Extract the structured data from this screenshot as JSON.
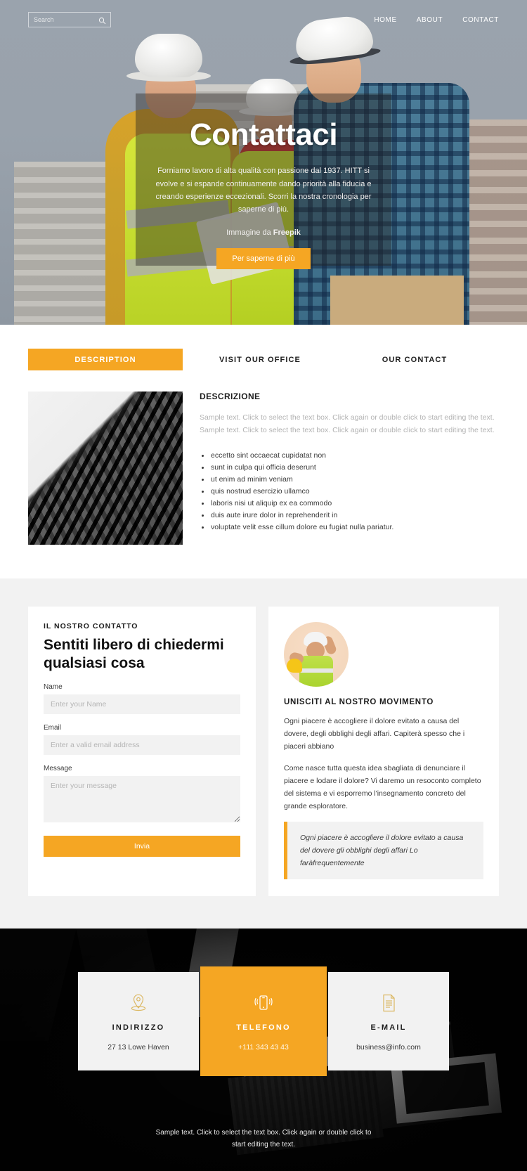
{
  "topbar": {
    "search": {
      "placeholder": "Search",
      "value": "",
      "icon": "search-icon"
    },
    "nav": [
      {
        "label": "HOME"
      },
      {
        "label": "ABOUT"
      },
      {
        "label": "CONTACT"
      }
    ]
  },
  "hero": {
    "title": "Contattaci",
    "description": "Forniamo lavoro di alta qualità con passione dal 1937. HITT si evolve e si espande continuamente dando priorità alla fiducia e creando esperienze eccezionali. Scorri la nostra cronologia per saperne di più.",
    "credit_prefix": "Immagine da ",
    "credit_source": "Freepik",
    "button_label": "Per saperne di più"
  },
  "tabs_section": {
    "tabs": [
      {
        "label": "DESCRIPTION",
        "active": true
      },
      {
        "label": "VISIT OUR OFFICE",
        "active": false
      },
      {
        "label": "OUR CONTACT",
        "active": false
      }
    ],
    "panel": {
      "title": "DESCRIZIONE",
      "paragraph": "Sample text. Click to select the text box. Click again or double click to start editing the text. Sample text. Click to select the text box. Click again or double click to start editing the text.",
      "list": [
        "eccetto sint occaecat cupidatat non",
        "sunt in culpa qui officia deserunt",
        "ut enim ad minim veniam",
        "quis nostrud esercizio ullamco",
        "laboris nisi ut aliquip ex ea commodo",
        "duis aute irure dolor in reprehenderit in",
        "voluptate velit esse cillum dolore eu fugiat nulla pariatur."
      ]
    }
  },
  "contact_section": {
    "form_card": {
      "eyebrow": "IL NOSTRO CONTATTO",
      "heading": "Sentiti libero di chiedermi qualsiasi cosa",
      "fields": [
        {
          "label": "Name",
          "placeholder": "Enter your Name",
          "value": ""
        },
        {
          "label": "Email",
          "placeholder": "Enter a valid email address",
          "value": ""
        },
        {
          "label": "Message",
          "placeholder": "Enter your message",
          "value": ""
        }
      ],
      "submit_label": "Invia"
    },
    "movement_card": {
      "avatar": "worker-avatar",
      "heading": "UNISCITI AL NOSTRO MOVIMENTO",
      "paragraph1": "Ogni piacere è accogliere il dolore evitato a causa del dovere, degli obblighi degli affari. Capiterà spesso che i piaceri abbiano",
      "paragraph2": "Come nasce tutta questa idea sbagliata di denunciare il piacere e lodare il dolore? Vi daremo un resoconto completo del sistema e vi esporremo l'insegnamento concreto del grande esploratore.",
      "quote": "Ogni piacere è accogliere il dolore evitato a causa del dovere gli obblighi degli affari Lo faràfrequentemente"
    }
  },
  "info_section": {
    "boxes": [
      {
        "icon": "map-pin-icon",
        "title": "INDIRIZZO",
        "value": "27 13 Lowe Haven",
        "accent": false
      },
      {
        "icon": "phone-icon",
        "title": "TELEFONO",
        "value": "+111 343 43 43",
        "accent": true
      },
      {
        "icon": "document-icon",
        "title": "E-MAIL",
        "value": "business@info.com",
        "accent": false
      }
    ],
    "footer_text": "Sample text. Click to select the text box. Click again or double click to start editing the text."
  },
  "colors": {
    "accent": "#f5a623",
    "dark": "#050505",
    "light_gray": "#f2f2f2",
    "text": "#1d1d1d",
    "muted": "#b3b3b3"
  }
}
